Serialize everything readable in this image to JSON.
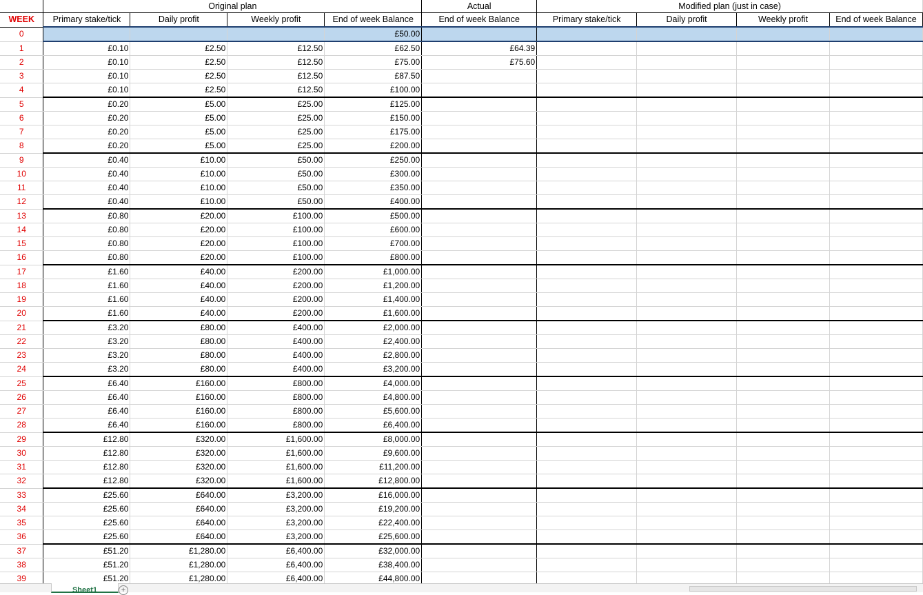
{
  "sheet": {
    "group_headers": {
      "original": "Original plan",
      "actual": "Actual",
      "modified": "Modified plan (just in case)"
    },
    "column_headers": {
      "week": "WEEK",
      "orig_stake": "Primary stake/tick",
      "orig_daily": "Daily profit",
      "orig_weekly": "Weekly profit",
      "orig_balance": "End of week Balance",
      "actual_balance": "End of week Balance",
      "mod_stake": "Primary stake/tick",
      "mod_daily": "Daily profit",
      "mod_weekly": "Weekly profit",
      "mod_balance": "End of week Balance"
    },
    "rows": [
      {
        "week": "0",
        "stake": "",
        "daily": "",
        "weekly": "",
        "balance": "£50.00",
        "actual": ""
      },
      {
        "week": "1",
        "stake": "£0.10",
        "daily": "£2.50",
        "weekly": "£12.50",
        "balance": "£62.50",
        "actual": "£64.39"
      },
      {
        "week": "2",
        "stake": "£0.10",
        "daily": "£2.50",
        "weekly": "£12.50",
        "balance": "£75.00",
        "actual": "£75.60"
      },
      {
        "week": "3",
        "stake": "£0.10",
        "daily": "£2.50",
        "weekly": "£12.50",
        "balance": "£87.50",
        "actual": ""
      },
      {
        "week": "4",
        "stake": "£0.10",
        "daily": "£2.50",
        "weekly": "£12.50",
        "balance": "£100.00",
        "actual": ""
      },
      {
        "week": "5",
        "stake": "£0.20",
        "daily": "£5.00",
        "weekly": "£25.00",
        "balance": "£125.00",
        "actual": ""
      },
      {
        "week": "6",
        "stake": "£0.20",
        "daily": "£5.00",
        "weekly": "£25.00",
        "balance": "£150.00",
        "actual": ""
      },
      {
        "week": "7",
        "stake": "£0.20",
        "daily": "£5.00",
        "weekly": "£25.00",
        "balance": "£175.00",
        "actual": ""
      },
      {
        "week": "8",
        "stake": "£0.20",
        "daily": "£5.00",
        "weekly": "£25.00",
        "balance": "£200.00",
        "actual": ""
      },
      {
        "week": "9",
        "stake": "£0.40",
        "daily": "£10.00",
        "weekly": "£50.00",
        "balance": "£250.00",
        "actual": ""
      },
      {
        "week": "10",
        "stake": "£0.40",
        "daily": "£10.00",
        "weekly": "£50.00",
        "balance": "£300.00",
        "actual": ""
      },
      {
        "week": "11",
        "stake": "£0.40",
        "daily": "£10.00",
        "weekly": "£50.00",
        "balance": "£350.00",
        "actual": ""
      },
      {
        "week": "12",
        "stake": "£0.40",
        "daily": "£10.00",
        "weekly": "£50.00",
        "balance": "£400.00",
        "actual": ""
      },
      {
        "week": "13",
        "stake": "£0.80",
        "daily": "£20.00",
        "weekly": "£100.00",
        "balance": "£500.00",
        "actual": ""
      },
      {
        "week": "14",
        "stake": "£0.80",
        "daily": "£20.00",
        "weekly": "£100.00",
        "balance": "£600.00",
        "actual": ""
      },
      {
        "week": "15",
        "stake": "£0.80",
        "daily": "£20.00",
        "weekly": "£100.00",
        "balance": "£700.00",
        "actual": ""
      },
      {
        "week": "16",
        "stake": "£0.80",
        "daily": "£20.00",
        "weekly": "£100.00",
        "balance": "£800.00",
        "actual": ""
      },
      {
        "week": "17",
        "stake": "£1.60",
        "daily": "£40.00",
        "weekly": "£200.00",
        "balance": "£1,000.00",
        "actual": ""
      },
      {
        "week": "18",
        "stake": "£1.60",
        "daily": "£40.00",
        "weekly": "£200.00",
        "balance": "£1,200.00",
        "actual": ""
      },
      {
        "week": "19",
        "stake": "£1.60",
        "daily": "£40.00",
        "weekly": "£200.00",
        "balance": "£1,400.00",
        "actual": ""
      },
      {
        "week": "20",
        "stake": "£1.60",
        "daily": "£40.00",
        "weekly": "£200.00",
        "balance": "£1,600.00",
        "actual": ""
      },
      {
        "week": "21",
        "stake": "£3.20",
        "daily": "£80.00",
        "weekly": "£400.00",
        "balance": "£2,000.00",
        "actual": ""
      },
      {
        "week": "22",
        "stake": "£3.20",
        "daily": "£80.00",
        "weekly": "£400.00",
        "balance": "£2,400.00",
        "actual": ""
      },
      {
        "week": "23",
        "stake": "£3.20",
        "daily": "£80.00",
        "weekly": "£400.00",
        "balance": "£2,800.00",
        "actual": ""
      },
      {
        "week": "24",
        "stake": "£3.20",
        "daily": "£80.00",
        "weekly": "£400.00",
        "balance": "£3,200.00",
        "actual": ""
      },
      {
        "week": "25",
        "stake": "£6.40",
        "daily": "£160.00",
        "weekly": "£800.00",
        "balance": "£4,000.00",
        "actual": ""
      },
      {
        "week": "26",
        "stake": "£6.40",
        "daily": "£160.00",
        "weekly": "£800.00",
        "balance": "£4,800.00",
        "actual": ""
      },
      {
        "week": "27",
        "stake": "£6.40",
        "daily": "£160.00",
        "weekly": "£800.00",
        "balance": "£5,600.00",
        "actual": ""
      },
      {
        "week": "28",
        "stake": "£6.40",
        "daily": "£160.00",
        "weekly": "£800.00",
        "balance": "£6,400.00",
        "actual": ""
      },
      {
        "week": "29",
        "stake": "£12.80",
        "daily": "£320.00",
        "weekly": "£1,600.00",
        "balance": "£8,000.00",
        "actual": ""
      },
      {
        "week": "30",
        "stake": "£12.80",
        "daily": "£320.00",
        "weekly": "£1,600.00",
        "balance": "£9,600.00",
        "actual": ""
      },
      {
        "week": "31",
        "stake": "£12.80",
        "daily": "£320.00",
        "weekly": "£1,600.00",
        "balance": "£11,200.00",
        "actual": ""
      },
      {
        "week": "32",
        "stake": "£12.80",
        "daily": "£320.00",
        "weekly": "£1,600.00",
        "balance": "£12,800.00",
        "actual": ""
      },
      {
        "week": "33",
        "stake": "£25.60",
        "daily": "£640.00",
        "weekly": "£3,200.00",
        "balance": "£16,000.00",
        "actual": ""
      },
      {
        "week": "34",
        "stake": "£25.60",
        "daily": "£640.00",
        "weekly": "£3,200.00",
        "balance": "£19,200.00",
        "actual": ""
      },
      {
        "week": "35",
        "stake": "£25.60",
        "daily": "£640.00",
        "weekly": "£3,200.00",
        "balance": "£22,400.00",
        "actual": ""
      },
      {
        "week": "36",
        "stake": "£25.60",
        "daily": "£640.00",
        "weekly": "£3,200.00",
        "balance": "£25,600.00",
        "actual": ""
      },
      {
        "week": "37",
        "stake": "£51.20",
        "daily": "£1,280.00",
        "weekly": "£6,400.00",
        "balance": "£32,000.00",
        "actual": ""
      },
      {
        "week": "38",
        "stake": "£51.20",
        "daily": "£1,280.00",
        "weekly": "£6,400.00",
        "balance": "£38,400.00",
        "actual": ""
      },
      {
        "week": "39",
        "stake": "£51.20",
        "daily": "£1,280.00",
        "weekly": "£6,400.00",
        "balance": "£44,800.00",
        "actual": ""
      }
    ]
  },
  "footer": {
    "sheet_tab": "Sheet1",
    "add_sheet_icon": "plus-circle-icon"
  }
}
